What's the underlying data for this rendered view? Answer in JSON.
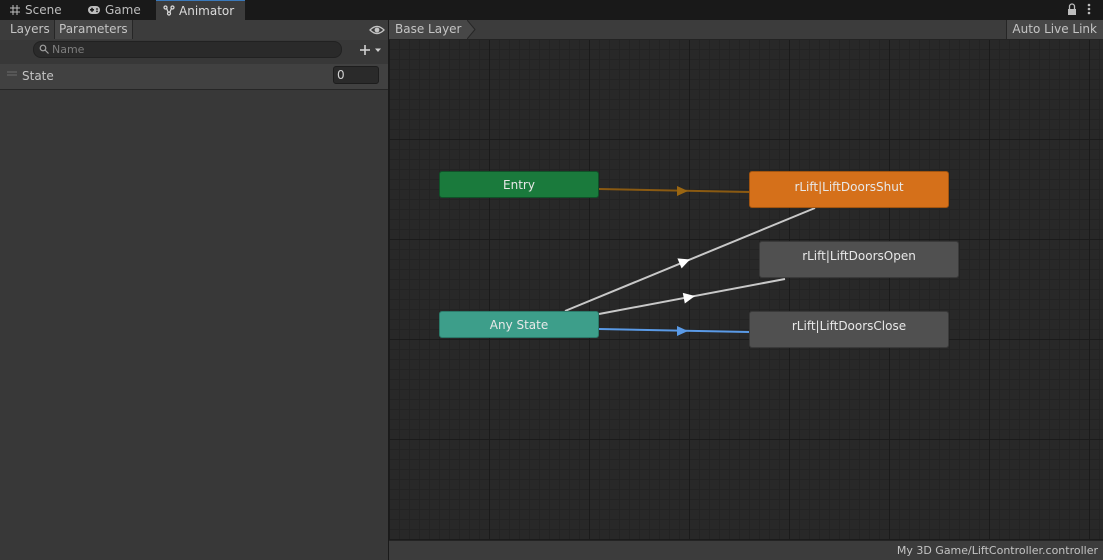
{
  "tabs": [
    {
      "label": "Scene",
      "icon": "grid-icon"
    },
    {
      "label": "Game",
      "icon": "gamepad-icon"
    },
    {
      "label": "Animator",
      "icon": "animator-icon",
      "active": true
    }
  ],
  "left_panel": {
    "tabs": [
      "Layers",
      "Parameters"
    ],
    "search": {
      "placeholder": "Name",
      "value": ""
    },
    "parameters": [
      {
        "name": "State",
        "value": "0"
      }
    ]
  },
  "graph": {
    "breadcrumb": "Base Layer",
    "auto_live_link": "Auto Live Link",
    "nodes": {
      "entry": "Entry",
      "any_state": "Any State",
      "shut": "rLift|LiftDoorsShut",
      "open": "rLift|LiftDoorsOpen",
      "close": "rLift|LiftDoorsClose"
    },
    "colors": {
      "entry": "#1a7a3c",
      "any_state": "#3d9e8a",
      "default_state": "#d5701a",
      "state": "#505050",
      "entry_transition": "#8a5a12",
      "transition": "#c8c8c8",
      "selected_transition": "#5a9ae6"
    }
  },
  "status_bar": {
    "path": "My 3D Game/LiftController.controller"
  }
}
